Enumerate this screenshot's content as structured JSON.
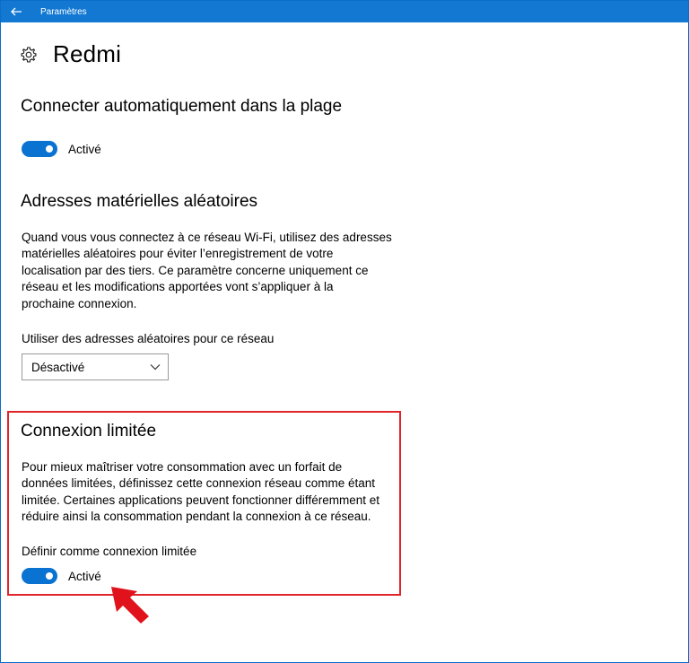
{
  "window": {
    "title": "Paramètres",
    "back_icon": "back-arrow-icon",
    "accent": "#1278d2"
  },
  "header": {
    "title": "Redmi",
    "icon": "gear-icon"
  },
  "auto_connect": {
    "heading": "Connecter automatiquement dans la plage",
    "toggle_state": "Activé",
    "toggle_on": true
  },
  "random_addresses": {
    "heading": "Adresses matérielles aléatoires",
    "description_lines": [
      "Quand vous vous connectez à ce réseau Wi-Fi, utilisez des adresses",
      "matérielles aléatoires pour éviter l’enregistrement de votre",
      "localisation par des tiers. Ce paramètre concerne uniquement ce",
      "réseau et les modifications apportées vont s’appliquer à la",
      "prochaine connexion."
    ],
    "select_label": "Utiliser des adresses aléatoires pour ce réseau",
    "select_value": "Désactivé"
  },
  "metered": {
    "heading": "Connexion limitée",
    "description_lines": [
      "Pour mieux maîtriser votre consommation avec un forfait de",
      "données limitées, définissez cette connexion réseau comme étant",
      "limitée. Certaines applications peuvent fonctionner différemment et",
      "réduire ainsi la consommation pendant la connexion à ce réseau."
    ],
    "toggle_label": "Définir comme connexion limitée",
    "toggle_state": "Activé",
    "toggle_on": true
  },
  "annotation": {
    "highlight_color": "#e0242a",
    "arrow_icon": "red-pointer-arrow-icon"
  }
}
